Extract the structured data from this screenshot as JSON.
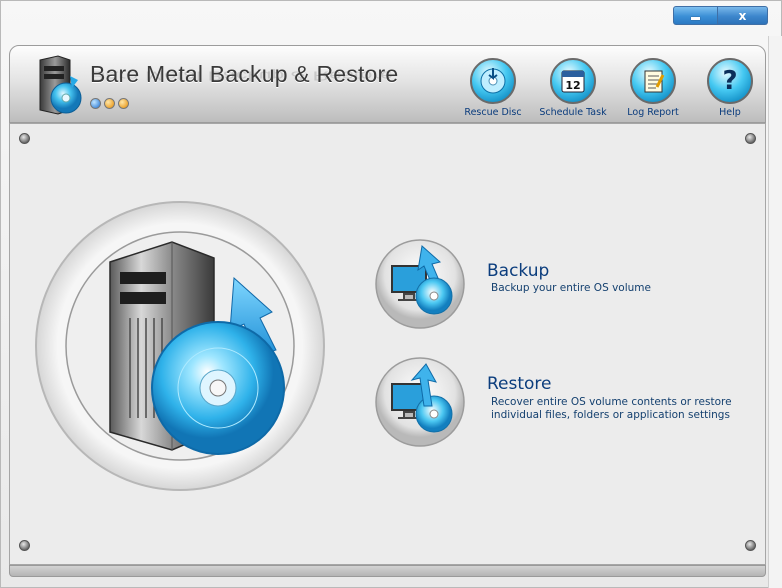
{
  "window": {
    "title_buttons": {
      "minimize": "",
      "close": "x"
    }
  },
  "header": {
    "app_title": "Bare Metal Backup & Restore",
    "toolbar": [
      {
        "id": "rescue-disc",
        "label": "Rescue Disc",
        "icon": "rescue-disc-icon"
      },
      {
        "id": "schedule-task",
        "label": "Schedule Task",
        "icon": "calendar-icon",
        "calendar_day": "12"
      },
      {
        "id": "log-report",
        "label": "Log Report",
        "icon": "notepad-icon"
      },
      {
        "id": "help",
        "label": "Help",
        "icon": "help-icon",
        "glyph": "?"
      }
    ]
  },
  "actions": {
    "backup": {
      "title": "Backup",
      "description": "Backup your entire OS volume",
      "icon": "backup-icon"
    },
    "restore": {
      "title": "Restore",
      "description_line1": "Recover entire OS volume contents or restore",
      "description_line2": "individual files, folders or application settings",
      "icon": "restore-icon"
    }
  },
  "colors": {
    "accent_blue": "#2aa8e0",
    "title_navy": "#0b3d7d",
    "panel_bg": "#ececec"
  }
}
